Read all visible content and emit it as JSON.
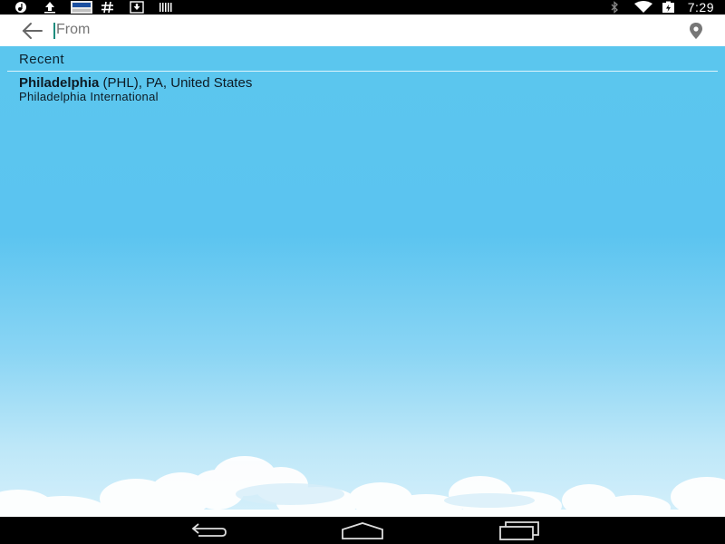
{
  "status_bar": {
    "time": "7:29",
    "left_icons": [
      "music-icon",
      "upload-icon",
      "news-app-icon",
      "hashtag-icon",
      "download-icon",
      "barcode-icon"
    ],
    "right_icons": [
      "bluetooth-icon",
      "wifi-icon",
      "battery-charging-icon"
    ]
  },
  "search": {
    "placeholder": "From",
    "value": ""
  },
  "recent": {
    "title": "Recent",
    "items": [
      {
        "city": "Philadelphia",
        "details": " (PHL), PA, United States",
        "airport": "Philadelphia International"
      }
    ]
  },
  "colors": {
    "sky_top": "#5bc6ee",
    "sky_bottom": "#d5f0fb",
    "cursor": "#1e8c7e"
  }
}
